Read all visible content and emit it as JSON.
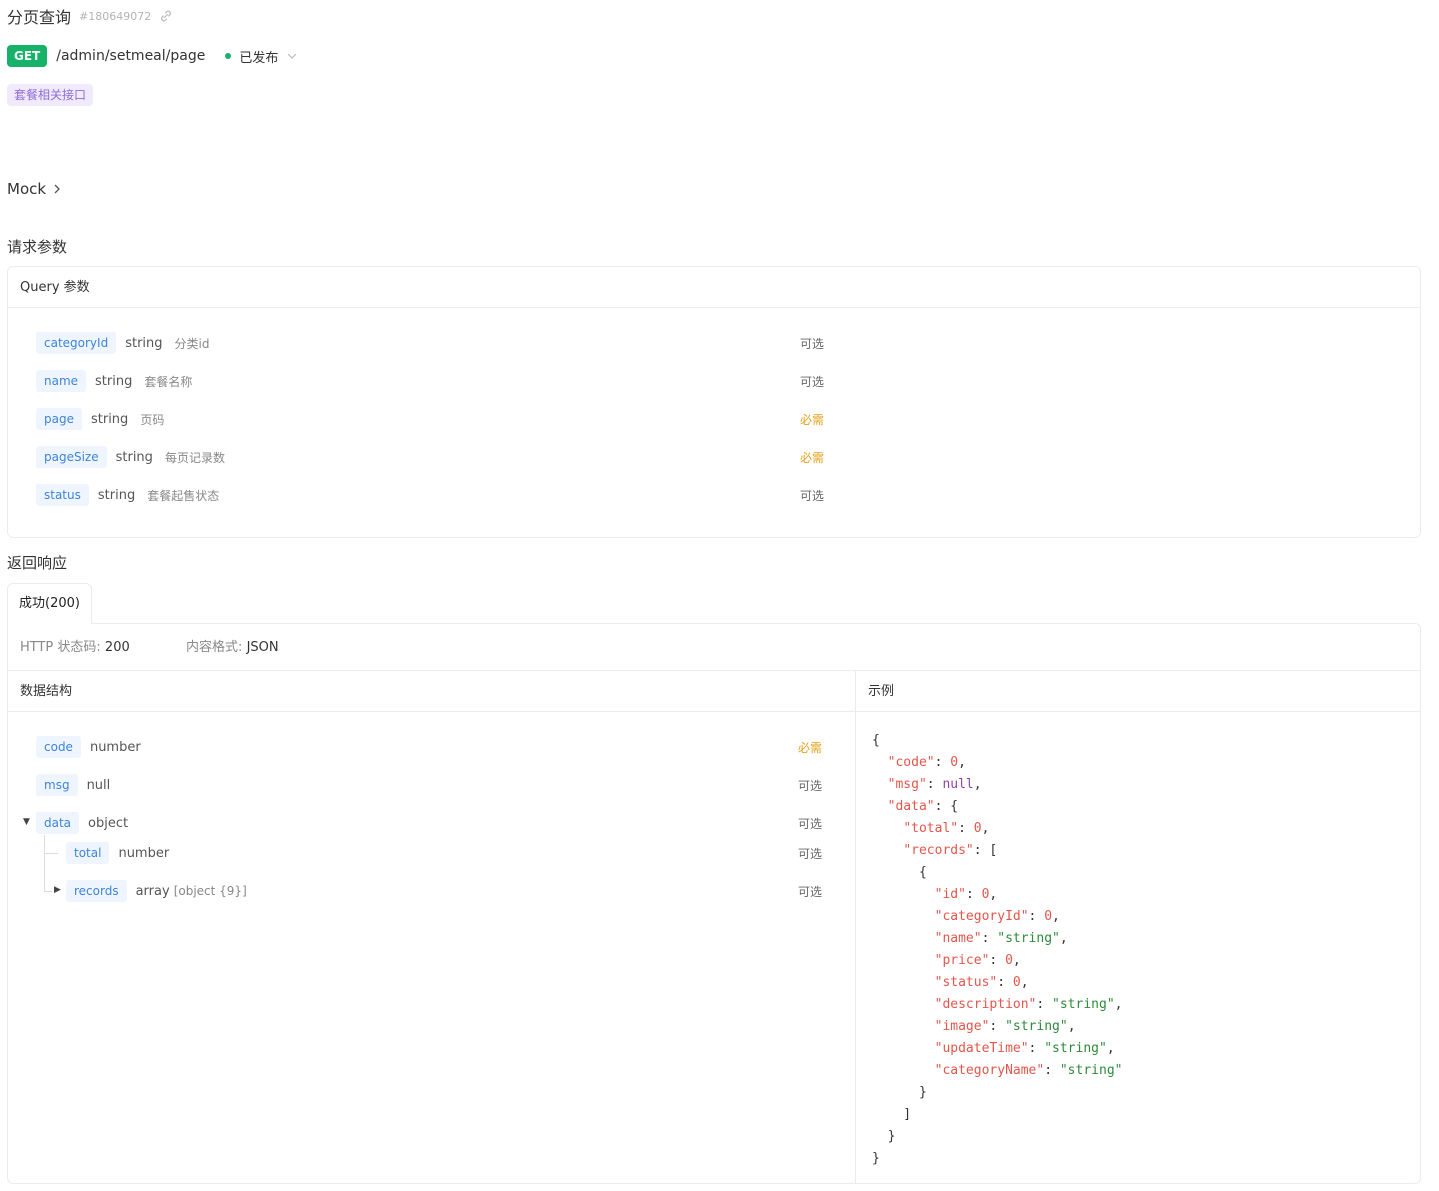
{
  "header": {
    "title": "分页查询",
    "api_id": "#180649072",
    "method": "GET",
    "path": "/admin/setmeal/page",
    "status": "已发布",
    "tag": "套餐相关接口",
    "mock_label": "Mock"
  },
  "request": {
    "section_title": "请求参数",
    "card_title": "Query 参数",
    "params": [
      {
        "name": "categoryId",
        "type": "string",
        "desc": "分类id",
        "flag": "可选"
      },
      {
        "name": "name",
        "type": "string",
        "desc": "套餐名称",
        "flag": "可选"
      },
      {
        "name": "page",
        "type": "string",
        "desc": "页码",
        "flag": "必需"
      },
      {
        "name": "pageSize",
        "type": "string",
        "desc": "每页记录数",
        "flag": "必需"
      },
      {
        "name": "status",
        "type": "string",
        "desc": "套餐起售状态",
        "flag": "可选"
      }
    ]
  },
  "response": {
    "section_title": "返回响应",
    "tab_label": "成功(200)",
    "status_label": "HTTP 状态码:",
    "status_value": "200",
    "format_label": "内容格式:",
    "format_value": "JSON",
    "schema_header": "数据结构",
    "example_header": "示例",
    "fields": [
      {
        "name": "code",
        "type": "number",
        "flag": "必需"
      },
      {
        "name": "msg",
        "type": "null",
        "flag": "可选"
      },
      {
        "name": "data",
        "type": "object",
        "flag": "可选"
      },
      {
        "name": "total",
        "type": "number",
        "flag": "可选"
      },
      {
        "name": "records",
        "type": "array",
        "note": "[object {9}]",
        "flag": "可选"
      }
    ]
  }
}
